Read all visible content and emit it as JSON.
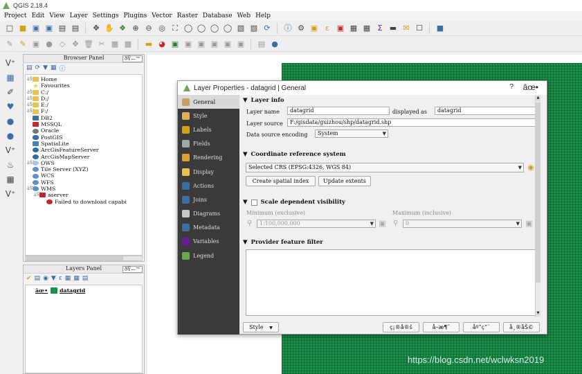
{
  "window": {
    "title": "QGIS 2.18.4"
  },
  "menu": [
    "Project",
    "Edit",
    "View",
    "Layer",
    "Settings",
    "Plugins",
    "Vector",
    "Raster",
    "Database",
    "Web",
    "Help"
  ],
  "browser_panel": {
    "title": "Browser Panel",
    "controls": "ðŸ—™",
    "items": [
      {
        "label": "Home",
        "expander": "âŠž",
        "indent": 0,
        "icon": "folder"
      },
      {
        "label": "Favourites",
        "expander": "",
        "indent": 0,
        "icon": "star"
      },
      {
        "label": "C:/",
        "expander": "âŠž",
        "indent": 0,
        "icon": "folder"
      },
      {
        "label": "D:/",
        "expander": "âŠž",
        "indent": 0,
        "icon": "folder"
      },
      {
        "label": "E:/",
        "expander": "âŠž",
        "indent": 0,
        "icon": "folder"
      },
      {
        "label": "F:/",
        "expander": "âŠž",
        "indent": 0,
        "icon": "folder"
      },
      {
        "label": "DB2",
        "expander": "",
        "indent": 0,
        "icon": "db2"
      },
      {
        "label": "MSSQL",
        "expander": "",
        "indent": 0,
        "icon": "mssql"
      },
      {
        "label": "Oracle",
        "expander": "",
        "indent": 0,
        "icon": "oracle"
      },
      {
        "label": "PostGIS",
        "expander": "",
        "indent": 0,
        "icon": "postgis"
      },
      {
        "label": "SpatiaLite",
        "expander": "",
        "indent": 0,
        "icon": "spatialite"
      },
      {
        "label": "ArcGisFeatureServer",
        "expander": "",
        "indent": 0,
        "icon": "arcgis"
      },
      {
        "label": "ArcGisMapServer",
        "expander": "",
        "indent": 0,
        "icon": "arcgis"
      },
      {
        "label": "OWS",
        "expander": "âŠž",
        "indent": 0,
        "icon": "ows"
      },
      {
        "label": "Tile Server (XYZ)",
        "expander": "",
        "indent": 0,
        "icon": "globe"
      },
      {
        "label": "WCS",
        "expander": "",
        "indent": 0,
        "icon": "globe"
      },
      {
        "label": "WFS",
        "expander": "",
        "indent": 0,
        "icon": "globe"
      },
      {
        "label": "WMS",
        "expander": "âŠŸ",
        "indent": 0,
        "icon": "globe"
      },
      {
        "label": "aserver",
        "expander": "âŠŸ",
        "indent": 1,
        "icon": "server"
      },
      {
        "label": "Failed to download capabi",
        "expander": "",
        "indent": 2,
        "icon": "error"
      }
    ]
  },
  "layers_panel": {
    "title": "Layers Panel",
    "controls": "ðŸ—™",
    "layer": {
      "name": "datagrid",
      "checked": "âœ•",
      "color": "#1e8f4a"
    }
  },
  "dialog": {
    "title": "Layer Properties - datagrid | General",
    "help": "?",
    "close": "âœ•",
    "sidebar": [
      {
        "label": "General",
        "active": true,
        "icon": "wrench-icon"
      },
      {
        "label": "Style",
        "active": false,
        "icon": "brush-icon"
      },
      {
        "label": "Labels",
        "active": false,
        "icon": "labels-icon"
      },
      {
        "label": "Fields",
        "active": false,
        "icon": "fields-icon"
      },
      {
        "label": "Rendering",
        "active": false,
        "icon": "rendering-icon"
      },
      {
        "label": "Display",
        "active": false,
        "icon": "display-icon"
      },
      {
        "label": "Actions",
        "active": false,
        "icon": "actions-icon"
      },
      {
        "label": "Joins",
        "active": false,
        "icon": "joins-icon"
      },
      {
        "label": "Diagrams",
        "active": false,
        "icon": "diagrams-icon"
      },
      {
        "label": "Metadata",
        "active": false,
        "icon": "info-icon"
      },
      {
        "label": "Variables",
        "active": false,
        "icon": "variables-icon"
      },
      {
        "label": "Legend",
        "active": false,
        "icon": "legend-icon"
      }
    ],
    "layer_info": {
      "header": "Layer info",
      "layer_name_label": "Layer name",
      "layer_name_value": "datagrid",
      "displayed_as_label": "displayed as",
      "displayed_as_value": "datagrid",
      "layer_source_label": "Layer source",
      "layer_source_value": "F:/gisdata/guizhou/shp/datagrid.shp",
      "encoding_label": "Data source encoding",
      "encoding_value": "System"
    },
    "crs": {
      "header": "Coordinate reference system",
      "selected": "Selected CRS (EPSG:4326, WGS 84)",
      "create_index_btn": "Create spatial index",
      "update_extents_btn": "Update extents"
    },
    "scale": {
      "header": "Scale dependent visibility",
      "min_label": "Minimum (exclusive)",
      "min_value": "1:100,000,000",
      "max_label": "Maximum (inclusive)",
      "max_value": "0"
    },
    "filter": {
      "header": "Provider feature filter"
    },
    "bottom": {
      "style_btn": "Style",
      "ok": "ç¡®å®š",
      "cancel": "å–æ¶ˆ",
      "apply": "åº”ç”¨",
      "help": "å¸®åŠ©"
    }
  },
  "watermark": "https://blog.csdn.net/wclwksn2019"
}
